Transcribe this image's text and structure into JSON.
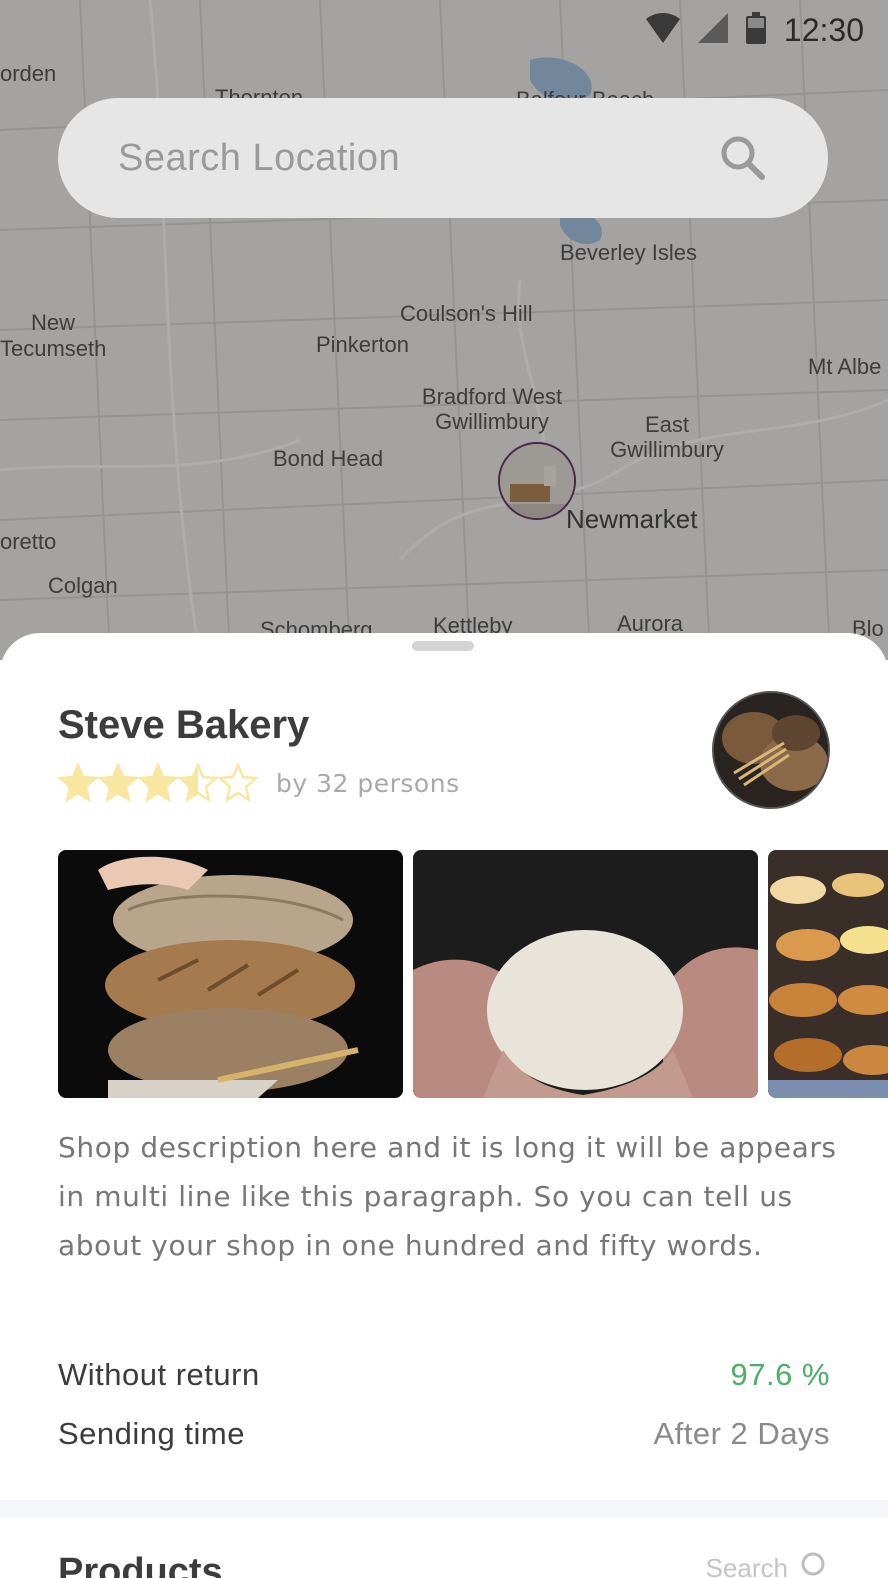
{
  "status_bar": {
    "time": "12:30"
  },
  "search": {
    "placeholder": "Search Location"
  },
  "map": {
    "labels": [
      "orden",
      "Thornton",
      "Balfour Beach",
      "Beverley Isles",
      "New Tecumseth",
      "Coulson's Hill",
      "Pinkerton",
      "Bradford West Gwillimbury",
      "East Gwillimbury",
      "Mt Albe",
      "Bond Head",
      "Newmarket",
      "oretto",
      "Colgan",
      "Schomberg",
      "Kettleby",
      "Aurora",
      "Blo"
    ]
  },
  "shop": {
    "name": "Steve Bakery",
    "rating": 3.5,
    "rating_max": 5,
    "rating_count": "by 32 persons",
    "description": "Shop description here and it is long it will be appears in multi line like this paragraph. So you can tell us about your shop in one hundred and fifty words.",
    "without_return_label": "Without return",
    "without_return_value": "97.6 %",
    "sending_time_label": "Sending time",
    "sending_time_value": "After 2 Days"
  },
  "products": {
    "title": "Products",
    "search_label": "Search"
  },
  "colors": {
    "star": "#f7e7a1",
    "accent_green": "#4caf63",
    "marker_border": "#6b3a6b"
  }
}
